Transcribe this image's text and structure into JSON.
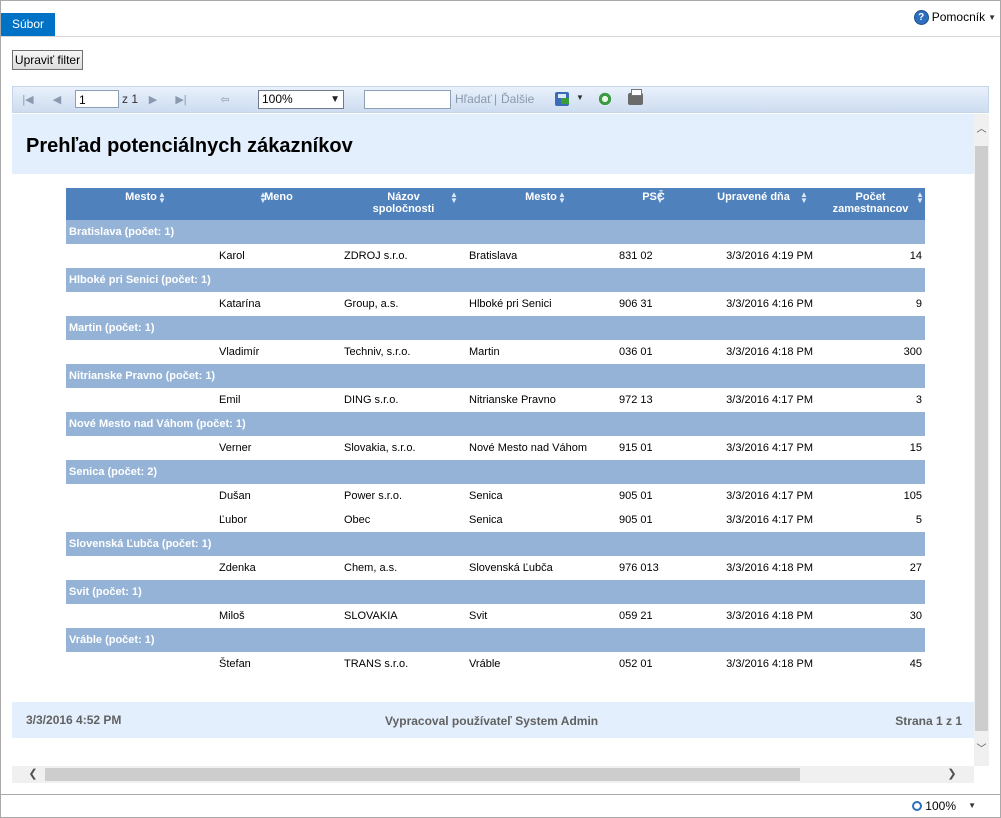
{
  "ribbon": {
    "file_tab": "Súbor",
    "help_label": "Pomocník"
  },
  "filter_button": "Upraviť filter",
  "toolbar": {
    "page_value": "1",
    "page_of": "z 1",
    "zoom": "100%",
    "find_label": "Hľadať",
    "separator": "|",
    "next_label": "Ďalšie"
  },
  "report": {
    "title": "Prehľad potenciálnych zákazníkov",
    "columns": [
      "Mesto",
      "Meno",
      "Názov spoločnosti",
      "Mesto",
      "PSČ",
      "Upravené dňa",
      "Počet zamestnancov"
    ],
    "groups": [
      {
        "label": "Bratislava (počet: 1)",
        "rows": [
          [
            "Karol",
            "ZDROJ s.r.o.",
            "Bratislava",
            "831 02",
            "3/3/2016 4:19 PM",
            "14"
          ]
        ]
      },
      {
        "label": "Hlboké pri Senici (počet: 1)",
        "rows": [
          [
            "Katarína",
            "Group, a.s.",
            "Hlboké pri Senici",
            "906 31",
            "3/3/2016 4:16 PM",
            "9"
          ]
        ]
      },
      {
        "label": "Martin (počet: 1)",
        "rows": [
          [
            "Vladimír",
            "Techniv, s.r.o.",
            "Martin",
            "036 01",
            "3/3/2016 4:18 PM",
            "300"
          ]
        ]
      },
      {
        "label": "Nitrianske Pravno (počet: 1)",
        "rows": [
          [
            "Emil",
            "DING s.r.o.",
            "Nitrianske Pravno",
            "972 13",
            "3/3/2016 4:17 PM",
            "3"
          ]
        ]
      },
      {
        "label": "Nové Mesto nad Váhom (počet: 1)",
        "rows": [
          [
            "Verner",
            "Slovakia, s.r.o.",
            "Nové Mesto nad Váhom",
            "915 01",
            "3/3/2016 4:17 PM",
            "15"
          ]
        ]
      },
      {
        "label": "Senica (počet: 2)",
        "rows": [
          [
            "Dušan",
            "Power s.r.o.",
            "Senica",
            "905 01",
            "3/3/2016 4:17 PM",
            "105"
          ],
          [
            "Ľubor",
            "Obec",
            "Senica",
            "905 01",
            "3/3/2016 4:17 PM",
            "5"
          ]
        ]
      },
      {
        "label": "Slovenská Ľubča (počet: 1)",
        "rows": [
          [
            "Zdenka",
            "Chem, a.s.",
            "Slovenská Ľubča",
            "976 013",
            "3/3/2016 4:18 PM",
            "27"
          ]
        ]
      },
      {
        "label": "Svit (počet: 1)",
        "rows": [
          [
            "Miloš",
            "SLOVAKIA",
            "Svit",
            "059 21",
            "3/3/2016 4:18 PM",
            "30"
          ]
        ]
      },
      {
        "label": "Vráble (počet: 1)",
        "rows": [
          [
            "Štefan",
            "TRANS s.r.o.",
            "Vráble",
            "052 01",
            "3/3/2016 4:18 PM",
            "45"
          ]
        ]
      }
    ],
    "footer": {
      "date": "3/3/2016 4:52 PM",
      "prepared_by": "Vypracoval používateľ System Admin",
      "page": "Strana 1 z 1"
    }
  },
  "status": {
    "zoom": "100%"
  },
  "colors": {
    "header_blue": "#4f81bd",
    "group_blue": "#95b3d7",
    "band": "#e4effd",
    "file_tab": "#0072c6"
  }
}
